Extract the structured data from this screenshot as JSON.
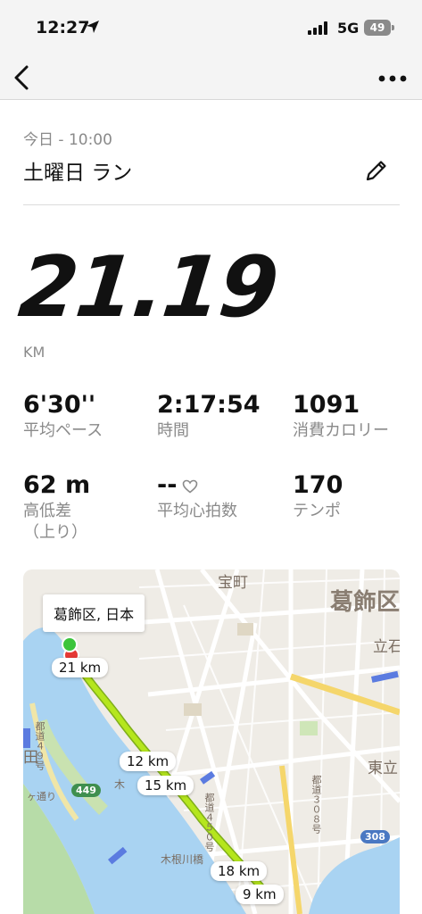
{
  "status_bar": {
    "time": "12:27",
    "network": "5G",
    "battery": "49"
  },
  "nav": {
    "back_icon": "chevron-left-icon",
    "more_icon": "more-horizontal-icon"
  },
  "activity": {
    "date": "今日 - 10:00",
    "title": "土曜日 ラン",
    "distance": "21.19",
    "distance_unit": "KM"
  },
  "stats": [
    {
      "value": "6'30''",
      "label": "平均ペース"
    },
    {
      "value": "2:17:54",
      "label": "時間"
    },
    {
      "value": "1091",
      "label": "消費カロリー"
    },
    {
      "value": "62 m",
      "label": "高低差\n（上り）"
    },
    {
      "value": "--",
      "label": "平均心拍数"
    },
    {
      "value": "170",
      "label": "テンポ"
    }
  ],
  "map": {
    "location": "葛飾区, 日本",
    "places": {
      "district": "葛飾区",
      "takaramachi": "宝町",
      "tateishi": "立石",
      "higashitate": "東立",
      "den": "田"
    },
    "road_numbers": {
      "r449": "449",
      "r308": "308"
    },
    "km_markers": [
      "21 km",
      "12 km",
      "15 km",
      "18 km",
      "9 km"
    ],
    "road_text": {
      "road_a": "都道４５０号",
      "road_b": "都道３０８号",
      "road_c": "都道４９号",
      "river": "木根川橋",
      "bridge": "木",
      "alley": "ヶ通り"
    },
    "colors": {
      "water": "#a9d3f2",
      "route": "#b5e61d",
      "start": "#3bc43b",
      "end": "#e53935"
    }
  }
}
